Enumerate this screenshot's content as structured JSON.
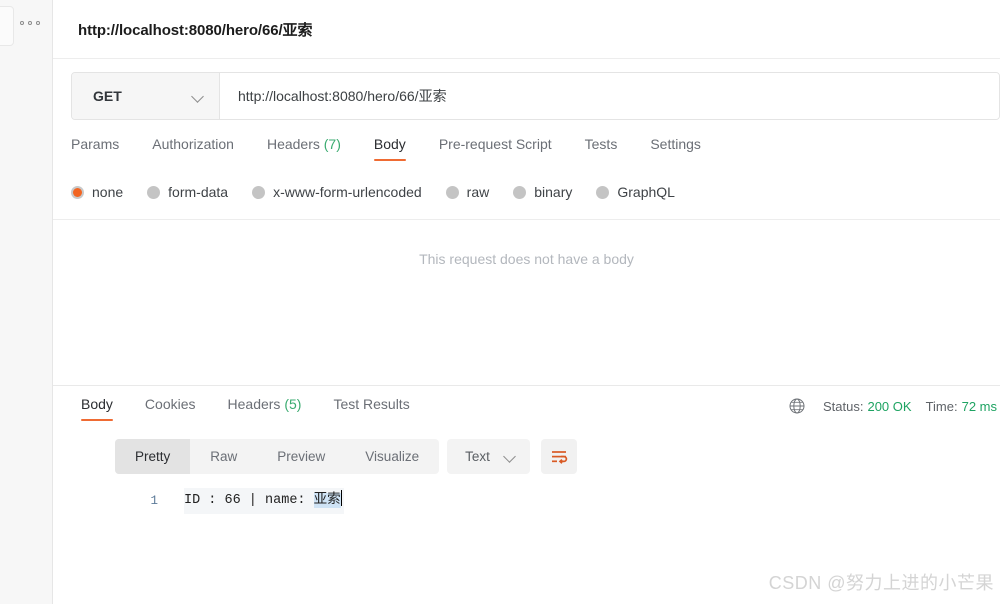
{
  "app": "Postman",
  "left_rail": {
    "menu_icon": "three-dots-icon"
  },
  "request": {
    "title": "http://localhost:8080/hero/66/亚索",
    "method": "GET",
    "url": "http://localhost:8080/hero/66/亚索",
    "tabs": [
      {
        "label": "Params",
        "active": false
      },
      {
        "label": "Authorization",
        "active": false
      },
      {
        "label": "Headers",
        "count": "(7)",
        "active": false
      },
      {
        "label": "Body",
        "active": true
      },
      {
        "label": "Pre-request Script",
        "active": false
      },
      {
        "label": "Tests",
        "active": false
      },
      {
        "label": "Settings",
        "active": false
      }
    ],
    "body_types": [
      {
        "label": "none",
        "selected": true
      },
      {
        "label": "form-data",
        "selected": false
      },
      {
        "label": "x-www-form-urlencoded",
        "selected": false
      },
      {
        "label": "raw",
        "selected": false
      },
      {
        "label": "binary",
        "selected": false
      },
      {
        "label": "GraphQL",
        "selected": false
      }
    ],
    "empty_body_message": "This request does not have a body"
  },
  "response": {
    "tabs": [
      {
        "label": "Body",
        "active": true
      },
      {
        "label": "Cookies",
        "active": false
      },
      {
        "label": "Headers",
        "count": "(5)",
        "active": false
      },
      {
        "label": "Test Results",
        "active": false
      }
    ],
    "meta": {
      "globe_icon": "globe-icon",
      "status_label": "Status:",
      "status_value": "200 OK",
      "time_label": "Time:",
      "time_value": "72 ms"
    },
    "view_modes": [
      {
        "label": "Pretty",
        "active": true
      },
      {
        "label": "Raw",
        "active": false
      },
      {
        "label": "Preview",
        "active": false
      },
      {
        "label": "Visualize",
        "active": false
      }
    ],
    "format": "Text",
    "wrap_icon": "wrap-text-icon",
    "body": {
      "line_number": "1",
      "text_prefix": "ID : 66 | name: ",
      "text_selected": "亚索"
    }
  },
  "watermark": "CSDN @努力上进的小芒果",
  "colors": {
    "accent": "#ef6b33",
    "success": "#1ea362",
    "rail_bg": "#f7f7f7",
    "selection": "#cfe3f5"
  }
}
